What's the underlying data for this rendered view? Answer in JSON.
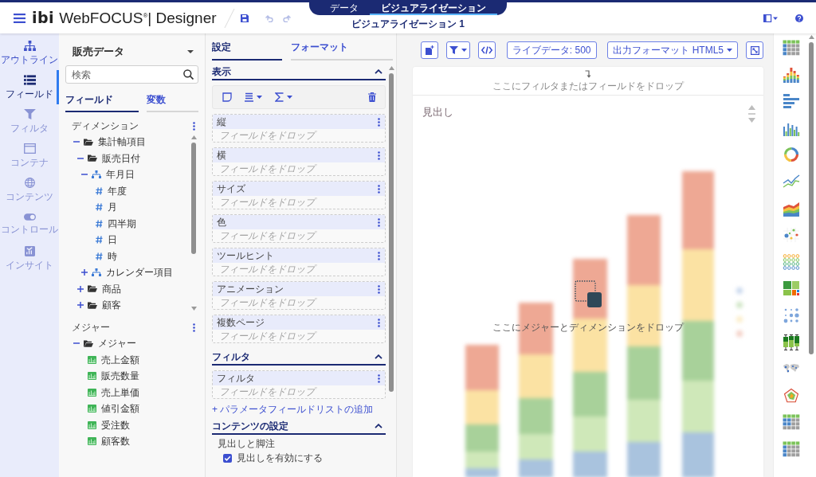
{
  "topbar": {
    "logo": "ibi",
    "product": "WebFOCUS$^{®}$| Designer",
    "history": {
      "undo": {
        "disabled": true
      },
      "redo": {
        "disabled": true
      }
    },
    "mode_tabs": [
      {
        "label": "データ",
        "selected": false
      },
      {
        "label": "ビジュアライゼーション",
        "selected": true
      }
    ],
    "document_title": "ビジュアライゼーション 1"
  },
  "rail": [
    {
      "label": "アウトライン",
      "selected": false,
      "disabled": false
    },
    {
      "label": "フィールド",
      "selected": true,
      "disabled": false
    },
    {
      "label": "フィルタ",
      "selected": false,
      "disabled": true
    },
    {
      "label": "コンテナ",
      "selected": false,
      "disabled": true
    },
    {
      "label": "コンテンツ",
      "selected": false,
      "disabled": true
    },
    {
      "label": "コントロール",
      "selected": false,
      "disabled": true
    },
    {
      "label": "インサイト",
      "selected": false,
      "disabled": true
    }
  ],
  "field_panel": {
    "title": "販売データ",
    "search": {
      "placeholder": "検索"
    },
    "tabs": [
      {
        "label": "フィールド",
        "selected": true
      },
      {
        "label": "変数",
        "selected": false
      }
    ],
    "sections": [
      {
        "title": "ディメンション",
        "tree": [
          {
            "label": "集計軸項目",
            "kind": "folder",
            "expanded": true,
            "children": [
              {
                "label": "販売日付",
                "kind": "folder",
                "expanded": true,
                "children": [
                  {
                    "label": "年月日",
                    "kind": "hierarchy",
                    "expanded": true,
                    "children": [
                      {
                        "label": "年度",
                        "kind": "field"
                      },
                      {
                        "label": "月",
                        "kind": "field"
                      },
                      {
                        "label": "四半期",
                        "kind": "field"
                      },
                      {
                        "label": "日",
                        "kind": "field"
                      },
                      {
                        "label": "時",
                        "kind": "field"
                      }
                    ]
                  },
                  {
                    "label": "カレンダー項目",
                    "kind": "hierarchy",
                    "expanded": false
                  }
                ]
              },
              {
                "label": "商品",
                "kind": "folder",
                "expanded": false
              },
              {
                "label": "顧客",
                "kind": "folder",
                "expanded": false
              }
            ]
          }
        ]
      },
      {
        "title": "メジャー",
        "tree": [
          {
            "label": "メジャー",
            "kind": "folder",
            "expanded": true,
            "children": [
              {
                "label": "売上金額",
                "kind": "measure"
              },
              {
                "label": "販売数量",
                "kind": "measure"
              },
              {
                "label": "売上単価",
                "kind": "measure"
              },
              {
                "label": "値引金額",
                "kind": "measure"
              },
              {
                "label": "受注数",
                "kind": "measure"
              },
              {
                "label": "顧客数",
                "kind": "measure"
              }
            ]
          }
        ]
      }
    ]
  },
  "settings_panel": {
    "tabs": [
      {
        "label": "設定",
        "selected": true
      },
      {
        "label": "フォーマット",
        "selected": false
      }
    ],
    "display": {
      "title": "表示",
      "expanded": true,
      "zones": [
        {
          "label": "縦",
          "hint": "フィールドをドロップ"
        },
        {
          "label": "横",
          "hint": "フィールドをドロップ"
        },
        {
          "label": "サイズ",
          "hint": "フィールドをドロップ"
        },
        {
          "label": "色",
          "hint": "フィールドをドロップ"
        },
        {
          "label": "ツールヒント",
          "hint": "フィールドをドロップ"
        },
        {
          "label": "アニメーション",
          "hint": "フィールドをドロップ"
        },
        {
          "label": "複数ページ",
          "hint": "フィールドをドロップ"
        }
      ]
    },
    "filter": {
      "title": "フィルタ",
      "expanded": true,
      "zones": [
        {
          "label": "フィルタ",
          "hint": "フィールドをドロップ"
        }
      ],
      "add_link": "+ パラメータフィールドリストの追加"
    },
    "content_settings": {
      "title": "コンテンツの設定",
      "expanded": true,
      "group_label": "見出しと脚注",
      "checkbox": {
        "label": "見出しを有効にする",
        "checked": true
      }
    }
  },
  "canvas": {
    "live_data": "ライブデータ: 500",
    "output_format": "出力フォーマット HTML5",
    "filter_hint": "ここにフィルタまたはフィールドをドロップ",
    "heading": "見出し",
    "drop_hint": "ここにメジャーとディメンションをドロップ"
  }
}
